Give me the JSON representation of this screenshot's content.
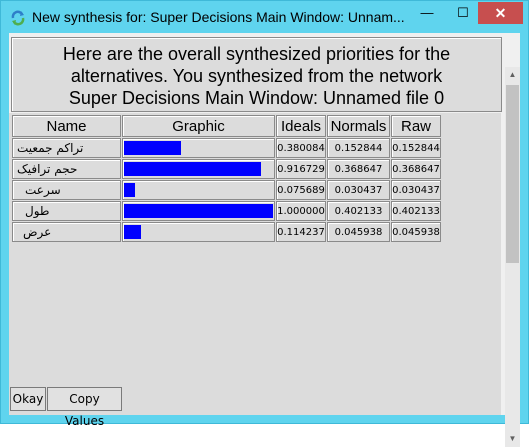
{
  "window": {
    "title": "New synthesis for: Super Decisions Main Window: Unnam...",
    "minimize_label": "—",
    "maximize_label": "☐",
    "close_label": "✕"
  },
  "header": {
    "line1": "Here are the overall synthesized priorities for the",
    "line2": "alternatives.  You synthesized from the network",
    "line3": "Super Decisions Main Window: Unnamed file 0"
  },
  "table": {
    "columns": [
      "Name",
      "Graphic",
      "Ideals",
      "Normals",
      "Raw"
    ],
    "bar_color": "#0000ff",
    "rows": [
      {
        "name": "تراكم جمعيت",
        "ideal": "0.380084",
        "normal": "0.152844",
        "raw": "0.152844",
        "ideal_value": 0.380084
      },
      {
        "name": "حجم ترافيک",
        "ideal": "0.916729",
        "normal": "0.368647",
        "raw": "0.368647",
        "ideal_value": 0.916729
      },
      {
        "name": "سرعت",
        "ideal": "0.075689",
        "normal": "0.030437",
        "raw": "0.030437",
        "ideal_value": 0.075689
      },
      {
        "name": "طول",
        "ideal": "1.000000",
        "normal": "0.402133",
        "raw": "0.402133",
        "ideal_value": 1.0
      },
      {
        "name": "عرض",
        "ideal": "0.114237",
        "normal": "0.045938",
        "raw": "0.045938",
        "ideal_value": 0.114237
      }
    ]
  },
  "buttons": {
    "okay": "Okay",
    "copy_values": "Copy Values"
  }
}
